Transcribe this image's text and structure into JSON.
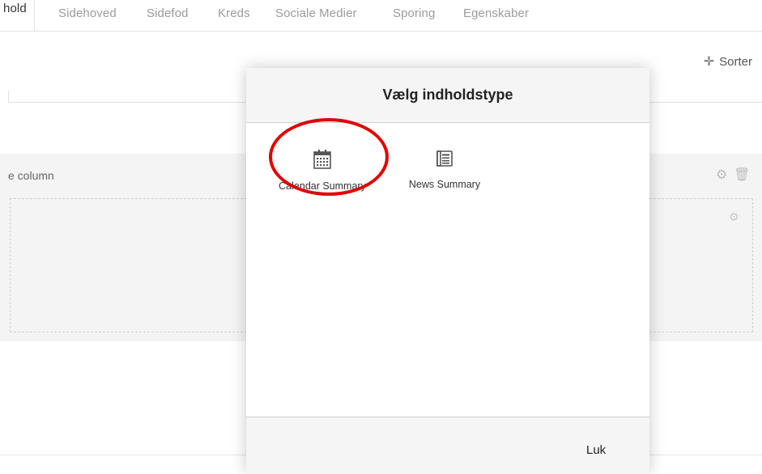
{
  "tabs": [
    {
      "label": "hold",
      "active": true
    },
    {
      "label": "Sidehoved"
    },
    {
      "label": "Sidefod"
    },
    {
      "label": "Kreds"
    },
    {
      "label": "Sociale Medier"
    },
    {
      "label": "Sporing"
    },
    {
      "label": "Egenskaber"
    }
  ],
  "toolbar": {
    "sorter_label": "Sorter",
    "sorter_icon": "move-icon"
  },
  "grid": {
    "column_label": "e column"
  },
  "modal": {
    "title": "Vælg indholdstype",
    "content_types": [
      {
        "label": "Calendar Summary",
        "icon": "calendar-icon"
      },
      {
        "label": "News Summary",
        "icon": "news-icon"
      }
    ],
    "close_label": "Luk"
  },
  "annotation": {
    "color": "#e10000"
  }
}
